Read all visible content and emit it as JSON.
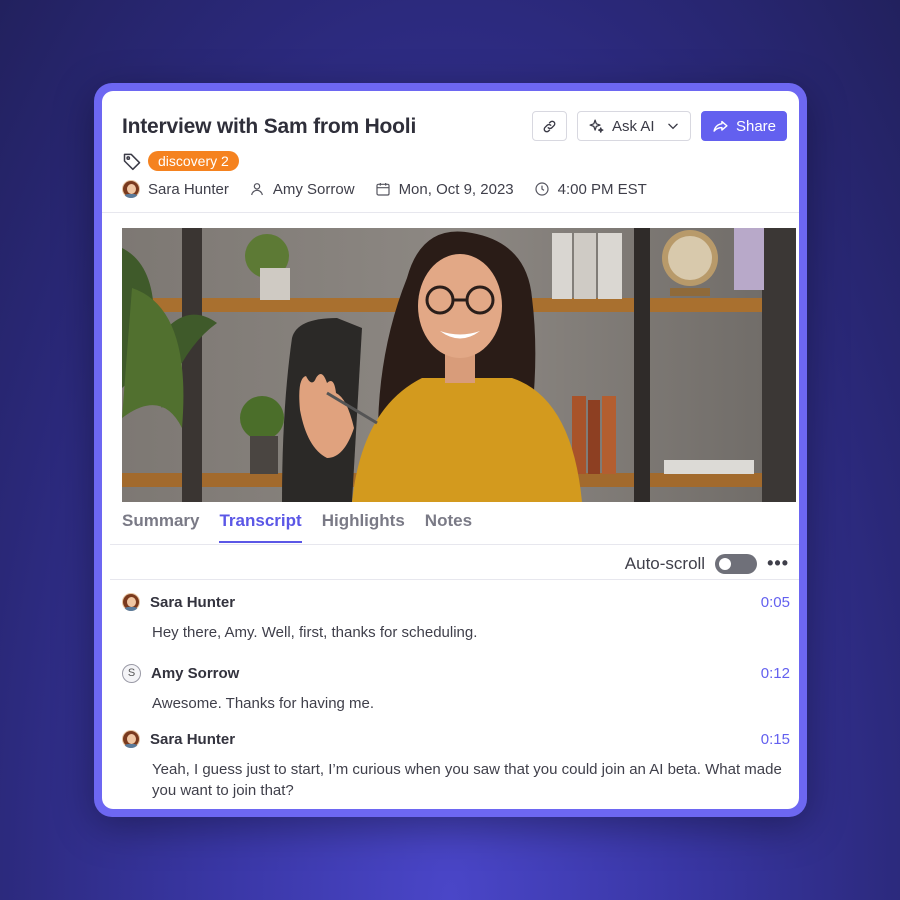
{
  "header": {
    "title": "Interview with Sam from Hooli",
    "ask_ai_label": "Ask AI",
    "share_label": "Share",
    "tag_label": "discovery 2",
    "host": "Sara Hunter",
    "guest": "Amy Sorrow",
    "date": "Mon, Oct 9, 2023",
    "time": "4:00 PM EST"
  },
  "tabs": [
    {
      "label": "Summary"
    },
    {
      "label": "Transcript"
    },
    {
      "label": "Highlights"
    },
    {
      "label": "Notes"
    }
  ],
  "toolbar": {
    "autoscroll_label": "Auto-scroll",
    "more_label": "•••"
  },
  "transcript": [
    {
      "speaker": "Sara Hunter",
      "time": "0:05",
      "text": "Hey there, Amy. Well, first, thanks for scheduling."
    },
    {
      "speaker": "Amy Sorrow",
      "initial": "S",
      "time": "0:12",
      "text": "Awesome. Thanks for having me."
    },
    {
      "speaker": "Sara Hunter",
      "time": "0:15",
      "text": "Yeah, I guess just to start, I’m curious when you saw that you could join an AI beta. What made you want to join that?"
    }
  ],
  "colors": {
    "accent": "#6360ef",
    "tag": "#f5821f",
    "frame": "#6d67f2"
  }
}
